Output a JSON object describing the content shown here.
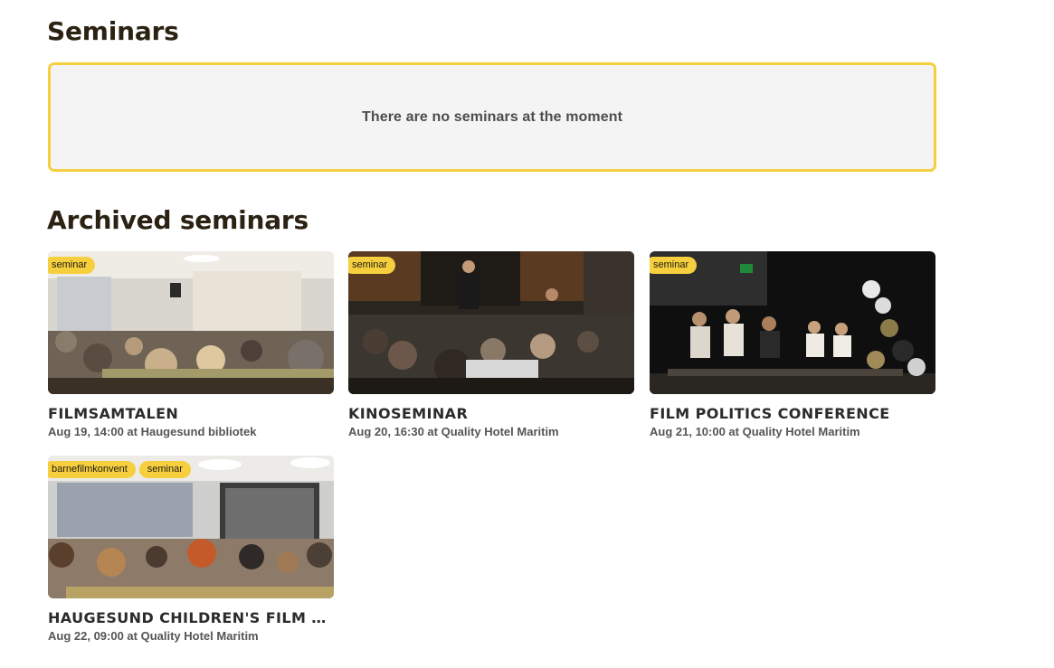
{
  "seminars": {
    "heading": "Seminars",
    "empty_message": "There are no seminars at the moment"
  },
  "archived": {
    "heading": "Archived seminars",
    "cards": [
      {
        "title": "FILMSAMTALEN",
        "subtitle": "Aug 19, 14:00 at Haugesund bibliotek",
        "tags": [
          "seminar"
        ],
        "image": "conference-room-audience-photo"
      },
      {
        "title": "KINOSEMINAR",
        "subtitle": "Aug 20, 16:30 at Quality Hotel Maritim",
        "tags": [
          "seminar"
        ],
        "image": "dark-seminar-room-photo"
      },
      {
        "title": "FILM POLITICS CONFERENCE",
        "subtitle": "Aug 21, 10:00 at Quality Hotel Maritim",
        "tags": [
          "seminar"
        ],
        "image": "stage-panel-discussion-photo"
      },
      {
        "title": "HAUGESUND CHILDREN'S FILM C...",
        "subtitle": "Aug 22, 09:00 at Quality Hotel Maritim",
        "tags": [
          "barnefilmkonvent",
          "seminar"
        ],
        "image": "presentation-audience-photo"
      }
    ]
  },
  "colors": {
    "accent": "#f6cf3f",
    "heading": "#2b2213",
    "empty_bg": "#f4f4f4"
  }
}
